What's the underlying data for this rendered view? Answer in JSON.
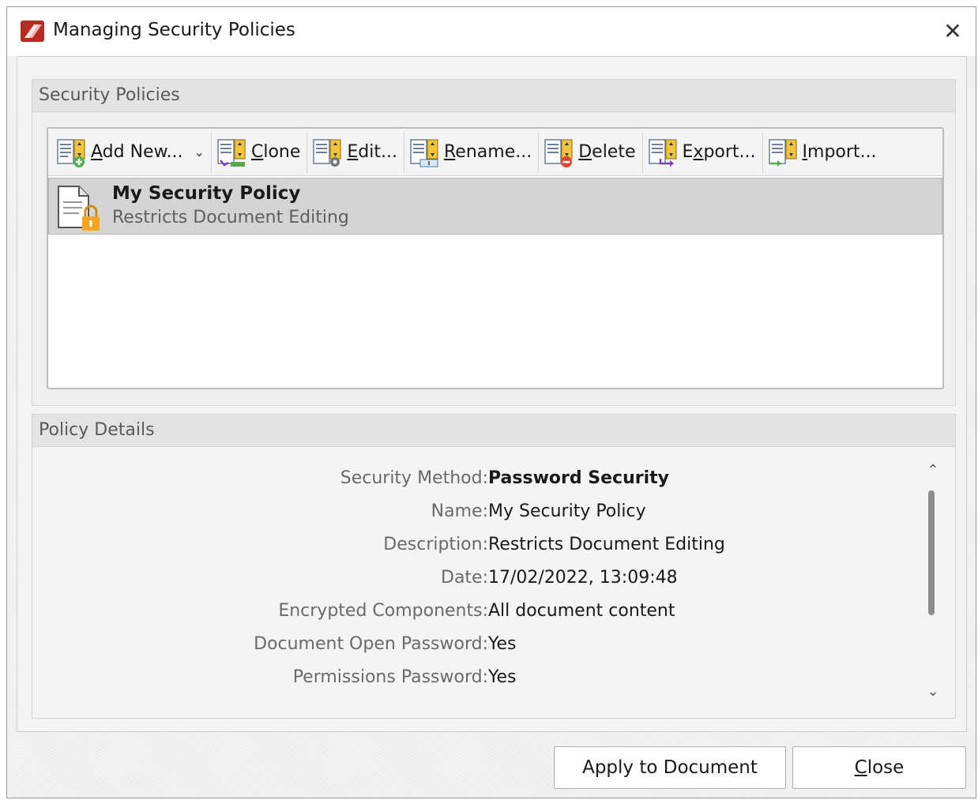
{
  "window": {
    "title": "Managing Security Policies"
  },
  "security_policies": {
    "header": "Security Policies",
    "toolbar": [
      {
        "label": "Add New...",
        "icon": "add-new-icon",
        "accel": "A",
        "dropdown": true
      },
      {
        "label": "Clone",
        "icon": "clone-icon",
        "accel": "C"
      },
      {
        "label": "Edit...",
        "icon": "edit-icon",
        "accel": "E"
      },
      {
        "label": "Rename...",
        "icon": "rename-icon",
        "accel": "R"
      },
      {
        "label": "Delete",
        "icon": "delete-icon",
        "accel": "D"
      },
      {
        "label": "Export...",
        "icon": "export-icon",
        "accel": "x"
      },
      {
        "label": "Import...",
        "icon": "import-icon",
        "accel": "I"
      }
    ],
    "policies": [
      {
        "name": "My Security Policy",
        "description": "Restricts Document Editing",
        "icon": "locked-document-icon"
      }
    ]
  },
  "policy_details": {
    "header": "Policy Details",
    "rows": [
      {
        "label": "Security Method:",
        "value": "Password Security",
        "bold": true
      },
      {
        "label": "Name:",
        "value": "My Security Policy"
      },
      {
        "label": "Description:",
        "value": "Restricts Document Editing"
      },
      {
        "label": "Date:",
        "value": "17/02/2022, 13:09:48"
      },
      {
        "label": "Encrypted Components:",
        "value": "All document content"
      },
      {
        "label": "Document Open Password:",
        "value": "Yes"
      },
      {
        "label": "Permissions Password:",
        "value": "Yes"
      }
    ]
  },
  "buttons": {
    "apply": "Apply to Document",
    "close": "Close"
  },
  "colors": {
    "accent_red": "#c8352b",
    "selection": "#d4d4d4",
    "lock": "#f4a623"
  }
}
